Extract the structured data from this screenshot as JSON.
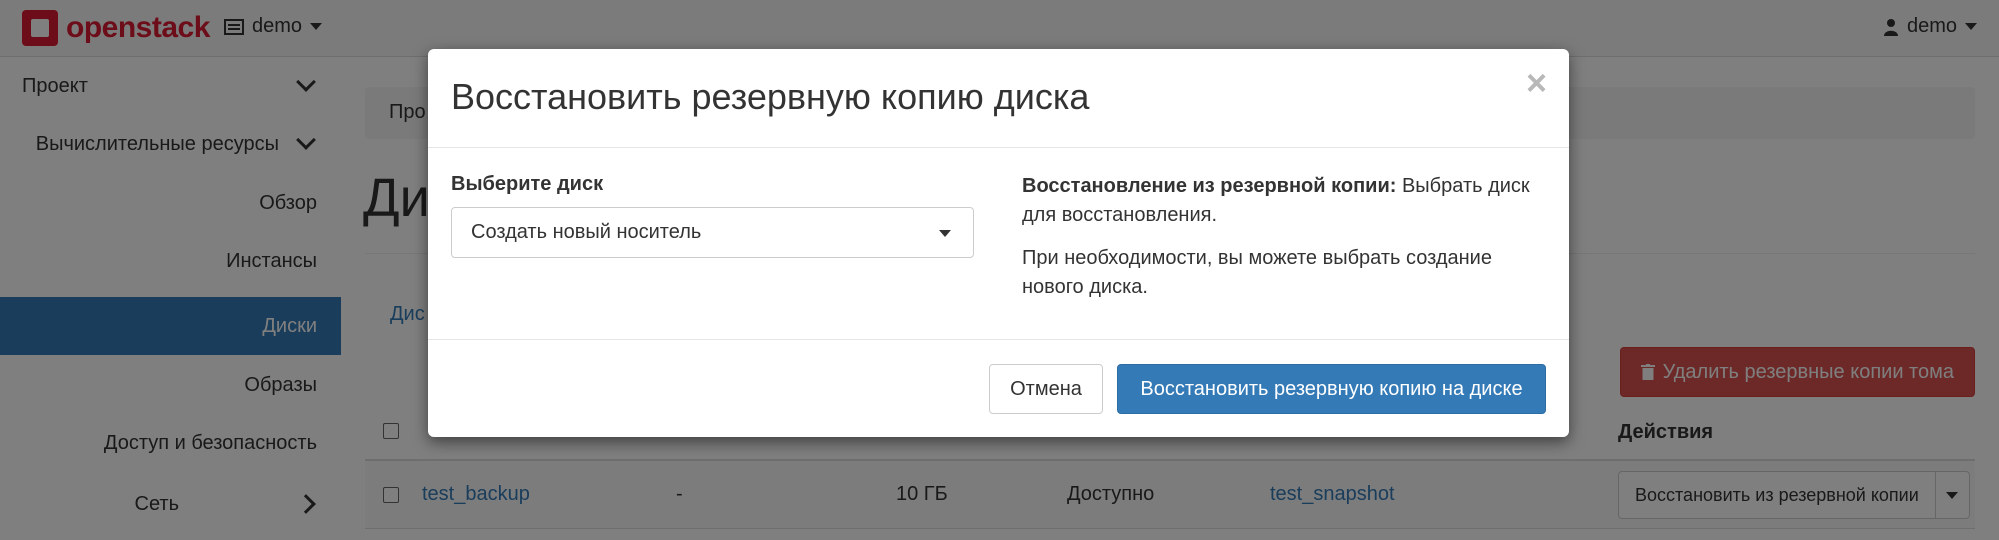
{
  "navbar": {
    "brand": "openstack",
    "project": "demo",
    "user": "demo"
  },
  "sidebar": {
    "items": [
      {
        "label": "Проект",
        "chevron": "down"
      },
      {
        "label": "Вычислительные ресурсы",
        "chevron": "down"
      },
      {
        "label": "Обзор"
      },
      {
        "label": "Инстансы"
      },
      {
        "label": "Диски",
        "active": true
      },
      {
        "label": "Образы"
      },
      {
        "label": "Доступ и безопасность"
      },
      {
        "label": "Сеть",
        "chevron": "right"
      }
    ]
  },
  "main": {
    "breadcrumb": "Про",
    "title": "Ди",
    "tab": "Дис",
    "delete_button": "Удалить резервные копии тома",
    "table": {
      "header_actions": "Действия",
      "rows": [
        {
          "name": "test_backup",
          "description": "-",
          "size": "10 ГБ",
          "status": "Доступно",
          "snapshot": "test_snapshot",
          "action": "Восстановить из резервной копии"
        }
      ]
    }
  },
  "modal": {
    "title": "Восстановить резервную копию диска",
    "close": "×",
    "field_label": "Выберите диск",
    "select_value": "Создать новый носитель",
    "help_title": "Восстановление из резервной копии:",
    "help_text_1": "Выбрать диск для восстановления.",
    "help_text_2": "При необходимости, вы можете выбрать создание нового диска.",
    "cancel": "Отмена",
    "submit": "Восстановить резервную копию на диске"
  }
}
